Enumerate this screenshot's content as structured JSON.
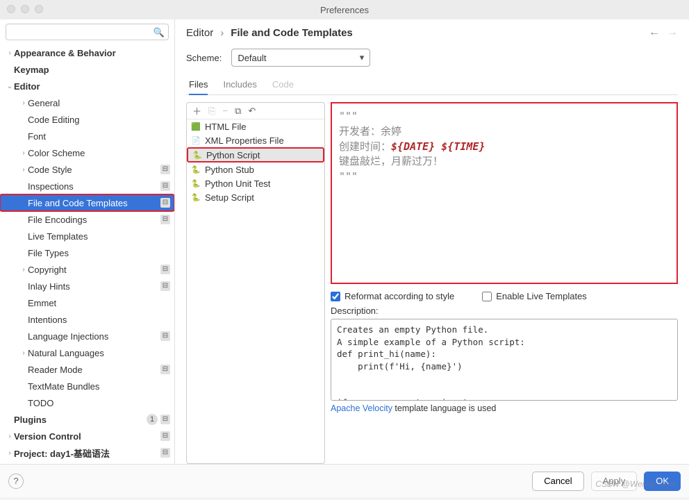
{
  "window": {
    "title": "Preferences"
  },
  "search": {
    "placeholder": ""
  },
  "breadcrumb": {
    "seg1": "Editor",
    "seg2": "File and Code Templates"
  },
  "scheme": {
    "label": "Scheme:",
    "value": "Default"
  },
  "tabs": [
    {
      "label": "Files",
      "current": true
    },
    {
      "label": "Includes",
      "current": false
    },
    {
      "label": "Code",
      "current": false,
      "disabled": true
    }
  ],
  "sidebar": [
    {
      "label": "Appearance & Behavior",
      "depth": 0,
      "expandable": true,
      "open": false,
      "bold": true
    },
    {
      "label": "Keymap",
      "depth": 0,
      "bold": true
    },
    {
      "label": "Editor",
      "depth": 0,
      "expandable": true,
      "open": true,
      "bold": true
    },
    {
      "label": "General",
      "depth": 1,
      "expandable": true,
      "open": false
    },
    {
      "label": "Code Editing",
      "depth": 1
    },
    {
      "label": "Font",
      "depth": 1
    },
    {
      "label": "Color Scheme",
      "depth": 1,
      "expandable": true,
      "open": false
    },
    {
      "label": "Code Style",
      "depth": 1,
      "expandable": true,
      "open": false,
      "gear": true
    },
    {
      "label": "Inspections",
      "depth": 1,
      "gear": true
    },
    {
      "label": "File and Code Templates",
      "depth": 1,
      "active": true,
      "highlight": true,
      "gear": true
    },
    {
      "label": "File Encodings",
      "depth": 1,
      "gear": true
    },
    {
      "label": "Live Templates",
      "depth": 1
    },
    {
      "label": "File Types",
      "depth": 1
    },
    {
      "label": "Copyright",
      "depth": 1,
      "expandable": true,
      "open": false,
      "gear": true
    },
    {
      "label": "Inlay Hints",
      "depth": 1,
      "gear": true
    },
    {
      "label": "Emmet",
      "depth": 1
    },
    {
      "label": "Intentions",
      "depth": 1
    },
    {
      "label": "Language Injections",
      "depth": 1,
      "gear": true
    },
    {
      "label": "Natural Languages",
      "depth": 1,
      "expandable": true,
      "open": false
    },
    {
      "label": "Reader Mode",
      "depth": 1,
      "gear": true
    },
    {
      "label": "TextMate Bundles",
      "depth": 1
    },
    {
      "label": "TODO",
      "depth": 1
    },
    {
      "label": "Plugins",
      "depth": 0,
      "bold": true,
      "count": "1",
      "gear": true
    },
    {
      "label": "Version Control",
      "depth": 0,
      "expandable": true,
      "open": false,
      "bold": true,
      "gear": true
    },
    {
      "label": "Project: day1-基础语法",
      "depth": 0,
      "expandable": true,
      "open": false,
      "bold": true,
      "gear": true
    }
  ],
  "templates": [
    {
      "label": "HTML File",
      "icon": "🟩"
    },
    {
      "label": "XML Properties File",
      "icon": "📄"
    },
    {
      "label": "Python Script",
      "icon": "🐍",
      "selected": true
    },
    {
      "label": "Python Stub",
      "icon": "🐍"
    },
    {
      "label": "Python Unit Test",
      "icon": "🐍"
    },
    {
      "label": "Setup Script",
      "icon": "🐍"
    }
  ],
  "code": {
    "q1": "\"\"\"",
    "l1a": "开发者：余婷",
    "l2a": "创建时间：",
    "l2b": "${DATE} ${TIME}",
    "l3a": "键盘敲烂，月薪过万！",
    "q2": "\"\"\""
  },
  "options": {
    "reformat_label": "Reformat according to style",
    "reformat_checked": true,
    "live_label": "Enable Live Templates",
    "live_checked": false
  },
  "description": {
    "label": "Description:",
    "text": "Creates an empty Python file.\nA simple example of a Python script:\ndef print_hi(name):\n    print(f'Hi, {name}')\n\n\nif __name__ == '__main__':\n    print_hi('Python')"
  },
  "template_lang": {
    "link": "Apache Velocity",
    "text": " template language is used"
  },
  "buttons": {
    "cancel": "Cancel",
    "apply": "Apply",
    "ok": "OK"
  },
  "watermark": "CSDN @Wendy_wyw"
}
